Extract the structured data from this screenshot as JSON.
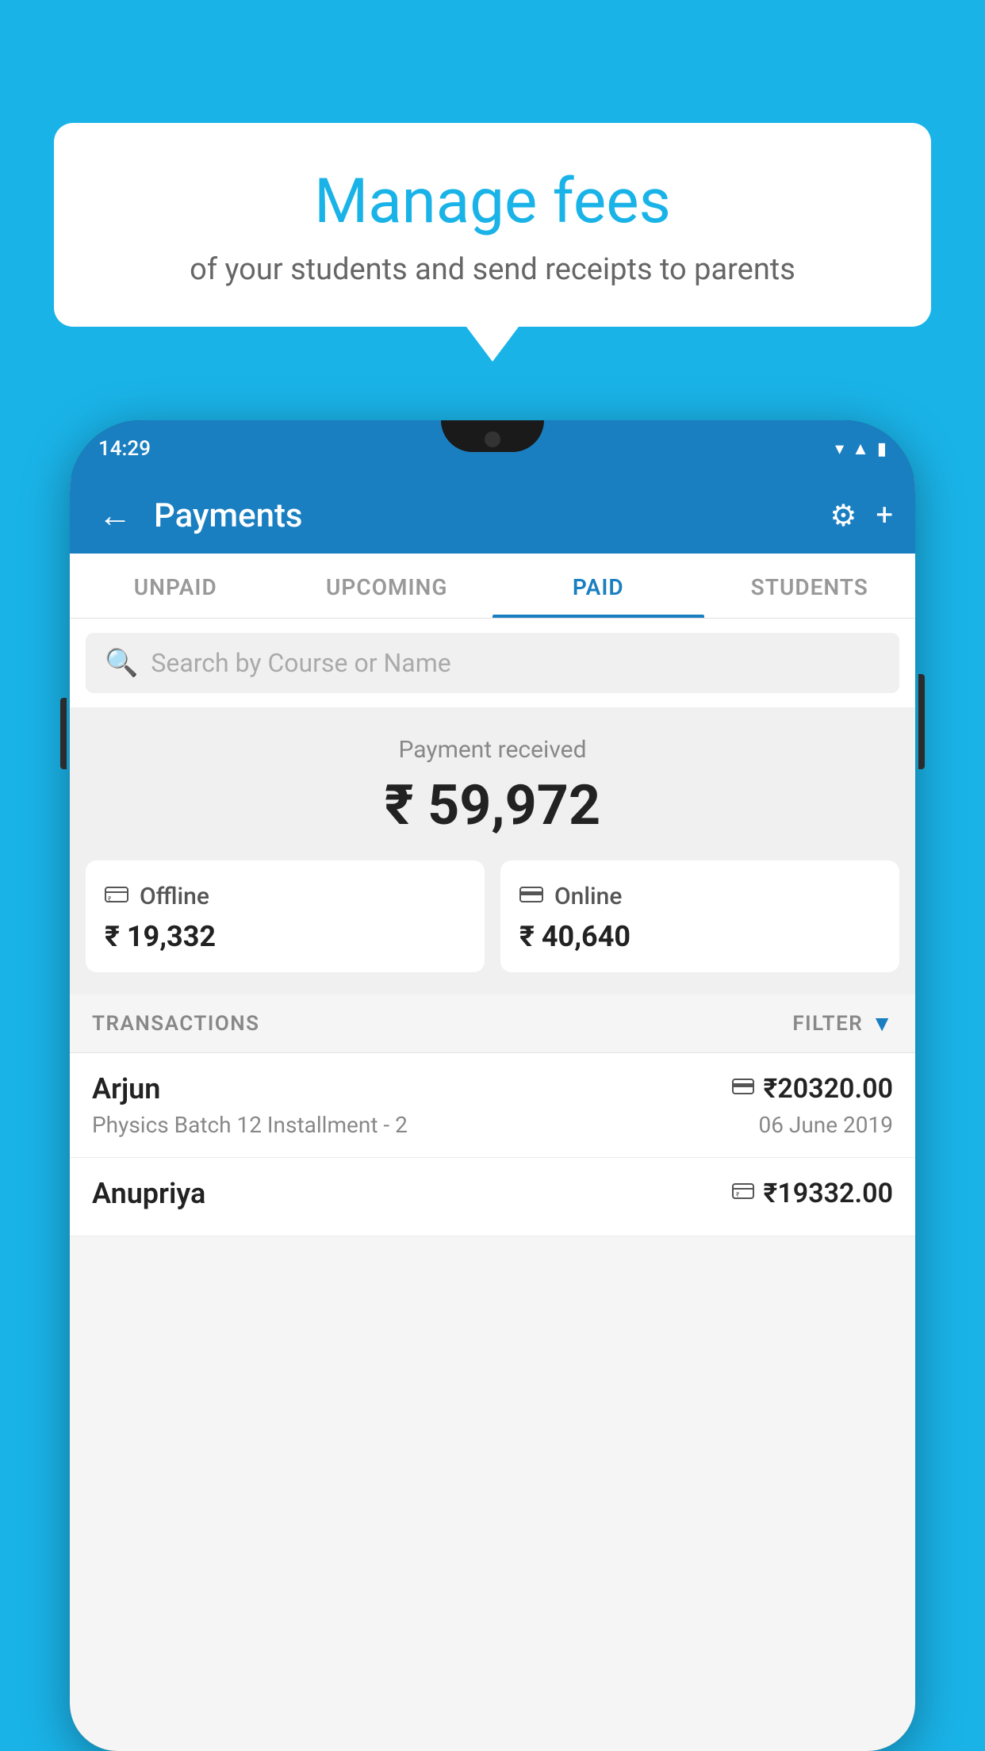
{
  "background_color": "#1ab3e8",
  "bubble": {
    "title": "Manage fees",
    "subtitle": "of your students and send receipts to parents"
  },
  "phone": {
    "status": {
      "time": "14:29",
      "icons": [
        "wifi",
        "signal",
        "battery"
      ]
    },
    "header": {
      "title": "Payments",
      "back_icon": "←",
      "settings_icon": "⚙",
      "add_icon": "+"
    },
    "tabs": [
      {
        "label": "UNPAID",
        "active": false
      },
      {
        "label": "UPCOMING",
        "active": false
      },
      {
        "label": "PAID",
        "active": true
      },
      {
        "label": "STUDENTS",
        "active": false
      }
    ],
    "search": {
      "placeholder": "Search by Course or Name"
    },
    "payment_received": {
      "label": "Payment received",
      "total": "₹ 59,972",
      "offline": {
        "icon": "💳",
        "label": "Offline",
        "amount": "₹ 19,332"
      },
      "online": {
        "icon": "💳",
        "label": "Online",
        "amount": "₹ 40,640"
      }
    },
    "transactions": {
      "header_label": "TRANSACTIONS",
      "filter_label": "FILTER",
      "rows": [
        {
          "name": "Arjun",
          "detail": "Physics Batch 12 Installment - 2",
          "amount": "₹20320.00",
          "date": "06 June 2019",
          "type": "online"
        },
        {
          "name": "Anupriya",
          "detail": "",
          "amount": "₹19332.00",
          "date": "",
          "type": "offline"
        }
      ]
    }
  }
}
